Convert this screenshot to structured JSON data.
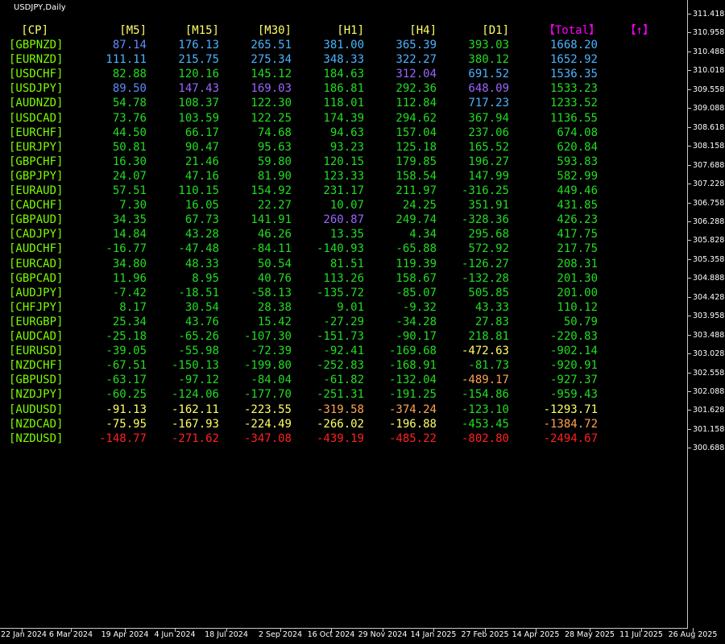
{
  "chart_title": "USDJPY,Daily",
  "price_axis": [
    "311.418",
    "310.958",
    "310.488",
    "310.018",
    "309.558",
    "309.088",
    "308.618",
    "308.158",
    "307.688",
    "307.228",
    "306.758",
    "306.288",
    "305.828",
    "305.358",
    "304.888",
    "304.428",
    "303.958",
    "303.488",
    "303.028",
    "302.558",
    "302.088",
    "301.628",
    "301.158",
    "300.688"
  ],
  "time_axis": [
    "22 Jan 2024",
    "6 Mar 2024",
    "19 Apr 2024",
    "4 Jun 2024",
    "18 Jul 2024",
    "2 Sep 2024",
    "16 Oct 2024",
    "29 Nov 2024",
    "14 Jan 2025",
    "27 Feb 2025",
    "14 Apr 2025",
    "28 May 2025",
    "11 Jul 2025",
    "26 Aug 2025"
  ],
  "colors": {
    "background": "#000000",
    "pair": "#7CFC00",
    "header": "#FFFF66",
    "total_header": "#FF00FF",
    "sky": "#4BB4FF",
    "blue": "#5B8CFF",
    "violet": "#9966FF",
    "green": "#22DD22",
    "light_green": "#66FF33",
    "yellow": "#FFFF66",
    "orange": "#FFA54F",
    "red": "#FF2020"
  },
  "table": {
    "headers": [
      "[CP]",
      "[M5]",
      "[M15]",
      "[M30]",
      "[H1]",
      "[H4]",
      "[D1]",
      "【Total】",
      "【↑】"
    ],
    "rows": [
      {
        "pair": "[GBPNZD]",
        "cells": [
          [
            "87.14",
            "blue"
          ],
          [
            "176.13",
            "sky"
          ],
          [
            "265.51",
            "sky"
          ],
          [
            "381.00",
            "sky"
          ],
          [
            "365.39",
            "sky"
          ],
          [
            "393.03",
            "green"
          ],
          [
            "1668.20",
            "sky"
          ]
        ]
      },
      {
        "pair": "[EURNZD]",
        "cells": [
          [
            "111.11",
            "sky"
          ],
          [
            "215.75",
            "sky"
          ],
          [
            "275.34",
            "sky"
          ],
          [
            "348.33",
            "sky"
          ],
          [
            "322.27",
            "sky"
          ],
          [
            "380.12",
            "green"
          ],
          [
            "1652.92",
            "sky"
          ]
        ]
      },
      {
        "pair": "[USDCHF]",
        "cells": [
          [
            "82.88",
            "green"
          ],
          [
            "120.16",
            "green"
          ],
          [
            "145.12",
            "green"
          ],
          [
            "184.63",
            "green"
          ],
          [
            "312.04",
            "violet"
          ],
          [
            "691.52",
            "sky"
          ],
          [
            "1536.35",
            "sky"
          ]
        ]
      },
      {
        "pair": "[USDJPY]",
        "cells": [
          [
            "89.50",
            "blue"
          ],
          [
            "147.43",
            "violet"
          ],
          [
            "169.03",
            "violet"
          ],
          [
            "186.81",
            "green"
          ],
          [
            "292.36",
            "green"
          ],
          [
            "648.09",
            "violet"
          ],
          [
            "1533.23",
            "green"
          ]
        ]
      },
      {
        "pair": "[AUDNZD]",
        "cells": [
          [
            "54.78",
            "green"
          ],
          [
            "108.37",
            "green"
          ],
          [
            "122.30",
            "green"
          ],
          [
            "118.01",
            "green"
          ],
          [
            "112.84",
            "green"
          ],
          [
            "717.23",
            "sky"
          ],
          [
            "1233.52",
            "green"
          ]
        ]
      },
      {
        "pair": "[USDCAD]",
        "cells": [
          [
            "73.76",
            "green"
          ],
          [
            "103.59",
            "green"
          ],
          [
            "122.25",
            "green"
          ],
          [
            "174.39",
            "green"
          ],
          [
            "294.62",
            "green"
          ],
          [
            "367.94",
            "green"
          ],
          [
            "1136.55",
            "green"
          ]
        ]
      },
      {
        "pair": "[EURCHF]",
        "cells": [
          [
            "44.50",
            "green"
          ],
          [
            "66.17",
            "green"
          ],
          [
            "74.68",
            "green"
          ],
          [
            "94.63",
            "green"
          ],
          [
            "157.04",
            "green"
          ],
          [
            "237.06",
            "green"
          ],
          [
            "674.08",
            "green"
          ]
        ]
      },
      {
        "pair": "[EURJPY]",
        "cells": [
          [
            "50.81",
            "green"
          ],
          [
            "90.47",
            "green"
          ],
          [
            "95.63",
            "green"
          ],
          [
            "93.23",
            "green"
          ],
          [
            "125.18",
            "green"
          ],
          [
            "165.52",
            "green"
          ],
          [
            "620.84",
            "green"
          ]
        ]
      },
      {
        "pair": "[GBPCHF]",
        "cells": [
          [
            "16.30",
            "green"
          ],
          [
            "21.46",
            "green"
          ],
          [
            "59.80",
            "green"
          ],
          [
            "120.15",
            "green"
          ],
          [
            "179.85",
            "green"
          ],
          [
            "196.27",
            "green"
          ],
          [
            "593.83",
            "green"
          ]
        ]
      },
      {
        "pair": "[GBPJPY]",
        "cells": [
          [
            "24.07",
            "green"
          ],
          [
            "47.16",
            "green"
          ],
          [
            "81.90",
            "green"
          ],
          [
            "123.33",
            "green"
          ],
          [
            "158.54",
            "green"
          ],
          [
            "147.99",
            "green"
          ],
          [
            "582.99",
            "green"
          ]
        ]
      },
      {
        "pair": "[EURAUD]",
        "cells": [
          [
            "57.51",
            "green"
          ],
          [
            "110.15",
            "green"
          ],
          [
            "154.92",
            "green"
          ],
          [
            "231.17",
            "green"
          ],
          [
            "211.97",
            "green"
          ],
          [
            "-316.25",
            "green"
          ],
          [
            "449.46",
            "green"
          ]
        ]
      },
      {
        "pair": "[CADCHF]",
        "cells": [
          [
            "7.30",
            "green"
          ],
          [
            "16.05",
            "green"
          ],
          [
            "22.27",
            "green"
          ],
          [
            "10.07",
            "green"
          ],
          [
            "24.25",
            "green"
          ],
          [
            "351.91",
            "green"
          ],
          [
            "431.85",
            "green"
          ]
        ]
      },
      {
        "pair": "[GBPAUD]",
        "cells": [
          [
            "34.35",
            "green"
          ],
          [
            "67.73",
            "green"
          ],
          [
            "141.91",
            "green"
          ],
          [
            "260.87",
            "violet"
          ],
          [
            "249.74",
            "green"
          ],
          [
            "-328.36",
            "green"
          ],
          [
            "426.23",
            "green"
          ]
        ]
      },
      {
        "pair": "[CADJPY]",
        "cells": [
          [
            "14.84",
            "green"
          ],
          [
            "43.28",
            "green"
          ],
          [
            "46.26",
            "green"
          ],
          [
            "13.35",
            "green"
          ],
          [
            "4.34",
            "green"
          ],
          [
            "295.68",
            "green"
          ],
          [
            "417.75",
            "green"
          ]
        ]
      },
      {
        "pair": "[AUDCHF]",
        "cells": [
          [
            "-16.77",
            "green"
          ],
          [
            "-47.48",
            "green"
          ],
          [
            "-84.11",
            "green"
          ],
          [
            "-140.93",
            "green"
          ],
          [
            "-65.88",
            "green"
          ],
          [
            "572.92",
            "green"
          ],
          [
            "217.75",
            "green"
          ]
        ]
      },
      {
        "pair": "[EURCAD]",
        "cells": [
          [
            "34.80",
            "green"
          ],
          [
            "48.33",
            "green"
          ],
          [
            "50.54",
            "green"
          ],
          [
            "81.51",
            "green"
          ],
          [
            "119.39",
            "green"
          ],
          [
            "-126.27",
            "green"
          ],
          [
            "208.31",
            "green"
          ]
        ]
      },
      {
        "pair": "[GBPCAD]",
        "cells": [
          [
            "11.96",
            "green"
          ],
          [
            "8.95",
            "green"
          ],
          [
            "40.76",
            "green"
          ],
          [
            "113.26",
            "green"
          ],
          [
            "158.67",
            "green"
          ],
          [
            "-132.28",
            "green"
          ],
          [
            "201.30",
            "green"
          ]
        ]
      },
      {
        "pair": "[AUDJPY]",
        "cells": [
          [
            "-7.42",
            "green"
          ],
          [
            "-18.51",
            "green"
          ],
          [
            "-58.13",
            "green"
          ],
          [
            "-135.72",
            "green"
          ],
          [
            "-85.07",
            "green"
          ],
          [
            "505.85",
            "green"
          ],
          [
            "201.00",
            "green"
          ]
        ]
      },
      {
        "pair": "[CHFJPY]",
        "cells": [
          [
            "8.17",
            "green"
          ],
          [
            "30.54",
            "green"
          ],
          [
            "28.38",
            "green"
          ],
          [
            "9.01",
            "green"
          ],
          [
            "-9.32",
            "green"
          ],
          [
            "43.33",
            "green"
          ],
          [
            "110.12",
            "green"
          ]
        ]
      },
      {
        "pair": "[EURGBP]",
        "cells": [
          [
            "25.34",
            "green"
          ],
          [
            "43.76",
            "green"
          ],
          [
            "15.42",
            "green"
          ],
          [
            "-27.29",
            "green"
          ],
          [
            "-34.28",
            "green"
          ],
          [
            "27.83",
            "green"
          ],
          [
            "50.79",
            "green"
          ]
        ]
      },
      {
        "pair": "[AUDCAD]",
        "cells": [
          [
            "-25.18",
            "green"
          ],
          [
            "-65.26",
            "green"
          ],
          [
            "-107.30",
            "green"
          ],
          [
            "-151.73",
            "green"
          ],
          [
            "-90.17",
            "green"
          ],
          [
            "218.81",
            "green"
          ],
          [
            "-220.83",
            "green"
          ]
        ]
      },
      {
        "pair": "[EURUSD]",
        "cells": [
          [
            "-39.05",
            "green"
          ],
          [
            "-55.98",
            "green"
          ],
          [
            "-72.39",
            "green"
          ],
          [
            "-92.41",
            "green"
          ],
          [
            "-169.68",
            "green"
          ],
          [
            "-472.63",
            "yellow"
          ],
          [
            "-902.14",
            "green"
          ]
        ]
      },
      {
        "pair": "[NZDCHF]",
        "cells": [
          [
            "-67.51",
            "green"
          ],
          [
            "-150.13",
            "green"
          ],
          [
            "-199.80",
            "green"
          ],
          [
            "-252.83",
            "green"
          ],
          [
            "-168.91",
            "green"
          ],
          [
            "-81.73",
            "green"
          ],
          [
            "-920.91",
            "green"
          ]
        ]
      },
      {
        "pair": "[GBPUSD]",
        "cells": [
          [
            "-63.17",
            "green"
          ],
          [
            "-97.12",
            "green"
          ],
          [
            "-84.04",
            "green"
          ],
          [
            "-61.82",
            "green"
          ],
          [
            "-132.04",
            "green"
          ],
          [
            "-489.17",
            "orange"
          ],
          [
            "-927.37",
            "green"
          ]
        ]
      },
      {
        "pair": "[NZDJPY]",
        "cells": [
          [
            "-60.25",
            "green"
          ],
          [
            "-124.06",
            "green"
          ],
          [
            "-177.70",
            "green"
          ],
          [
            "-251.31",
            "green"
          ],
          [
            "-191.25",
            "green"
          ],
          [
            "-154.86",
            "green"
          ],
          [
            "-959.43",
            "green"
          ]
        ]
      },
      {
        "pair": "[AUDUSD]",
        "cells": [
          [
            "-91.13",
            "yellow"
          ],
          [
            "-162.11",
            "yellow"
          ],
          [
            "-223.55",
            "yellow"
          ],
          [
            "-319.58",
            "orange"
          ],
          [
            "-374.24",
            "orange"
          ],
          [
            "-123.10",
            "green"
          ],
          [
            "-1293.71",
            "yellow"
          ]
        ]
      },
      {
        "pair": "[NZDCAD]",
        "cells": [
          [
            "-75.95",
            "yellow"
          ],
          [
            "-167.93",
            "yellow"
          ],
          [
            "-224.49",
            "yellow"
          ],
          [
            "-266.02",
            "yellow"
          ],
          [
            "-196.88",
            "yellow"
          ],
          [
            "-453.45",
            "green"
          ],
          [
            "-1384.72",
            "orange"
          ]
        ]
      },
      {
        "pair": "[NZDUSD]",
        "cells": [
          [
            "-148.77",
            "red"
          ],
          [
            "-271.62",
            "red"
          ],
          [
            "-347.08",
            "red"
          ],
          [
            "-439.19",
            "red"
          ],
          [
            "-485.22",
            "red"
          ],
          [
            "-802.80",
            "red"
          ],
          [
            "-2494.67",
            "red"
          ]
        ]
      }
    ]
  }
}
